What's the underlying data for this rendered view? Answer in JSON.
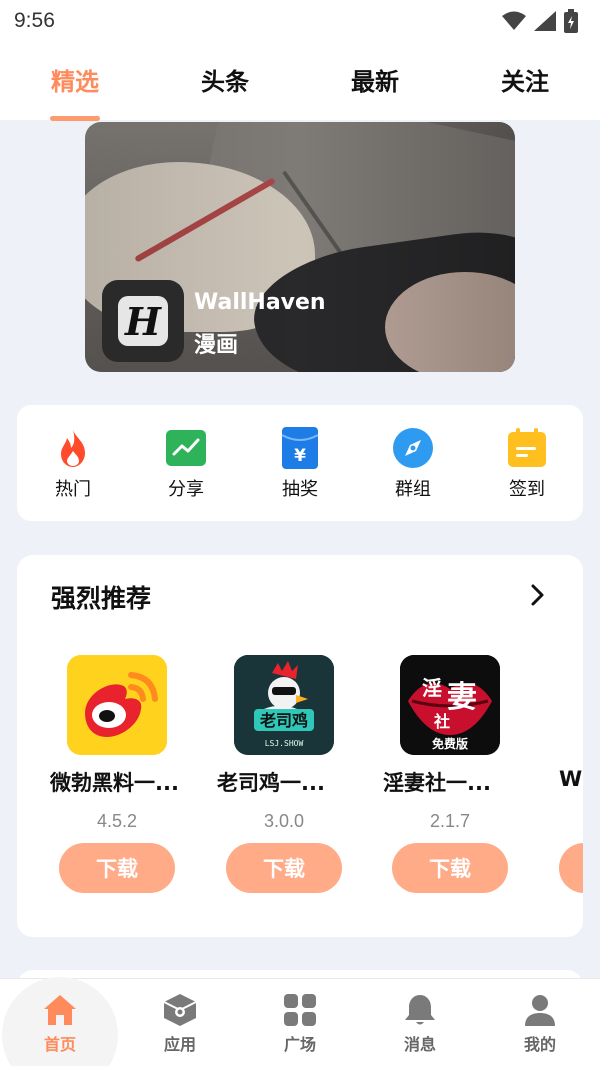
{
  "status_bar": {
    "time": "9:56"
  },
  "top_tabs": [
    {
      "label": "精选",
      "active": true
    },
    {
      "label": "头条",
      "active": false
    },
    {
      "label": "最新",
      "active": false
    },
    {
      "label": "关注",
      "active": false
    }
  ],
  "banner": {
    "app_name": "WallHaven",
    "category": "漫画",
    "logo_letter": "H"
  },
  "quick_actions": [
    {
      "label": "热门",
      "icon": "flame-icon",
      "color": "#ff4b2b"
    },
    {
      "label": "分享",
      "icon": "trend-chart-icon",
      "color": "#2fb35a"
    },
    {
      "label": "抽奖",
      "icon": "yen-envelope-icon",
      "color": "#1e7ce6"
    },
    {
      "label": "群组",
      "icon": "compass-icon",
      "color": "#2e9af0"
    },
    {
      "label": "签到",
      "icon": "calendar-icon",
      "color": "#ffbf1f"
    }
  ],
  "recommend": {
    "title": "强烈推荐",
    "apps": [
      {
        "name": "微勃黑料一...",
        "version": "4.5.2",
        "button": "下载",
        "icon": "weibo-logo-icon"
      },
      {
        "name": "老司鸡一...",
        "version": "3.0.0",
        "button": "下载",
        "icon": "rooster-logo-icon",
        "icon_text": "LSJ.SHOW"
      },
      {
        "name": "淫妻社一...",
        "version": "2.1.7",
        "button": "下载",
        "icon": "lips-logo-icon",
        "icon_text": "免费版"
      },
      {
        "name": "W",
        "version": "",
        "button": "",
        "icon": "partial-app"
      }
    ]
  },
  "bottom_nav": [
    {
      "label": "首页",
      "icon": "home-icon",
      "active": true
    },
    {
      "label": "应用",
      "icon": "cube-icon",
      "active": false
    },
    {
      "label": "广场",
      "icon": "grid-icon",
      "active": false
    },
    {
      "label": "消息",
      "icon": "bell-icon",
      "active": false
    },
    {
      "label": "我的",
      "icon": "user-icon",
      "active": false
    }
  ],
  "colors": {
    "accent": "#ff8a5b",
    "button": "#ffab88",
    "page_bg": "#eef2f8"
  }
}
